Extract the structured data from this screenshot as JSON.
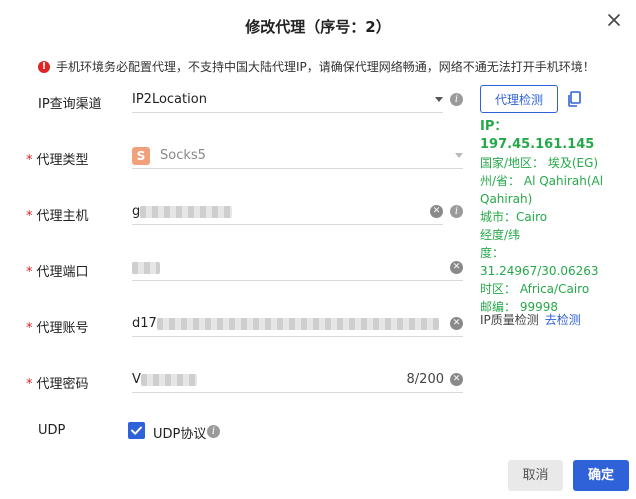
{
  "dialog": {
    "title": "修改代理（序号：2）"
  },
  "warning": {
    "text": "手机环境务必配置代理，不支持中国大陆代理IP，请确保代理网络畅通，网络不通无法打开手机环境！"
  },
  "form": {
    "channel": {
      "label": "IP查询渠道",
      "value": "IP2Location"
    },
    "proxy_type": {
      "label": "代理类型",
      "value": "Socks5",
      "icon_letter": "S"
    },
    "host": {
      "label": "代理主机",
      "value_prefix": "g"
    },
    "port": {
      "label": "代理端口"
    },
    "account": {
      "label": "代理账号",
      "value_prefix": "d17"
    },
    "password": {
      "label": "代理密码",
      "value_prefix": "V",
      "counter": "8/200"
    },
    "udp": {
      "label": "UDP",
      "checkbox_label": "UDP协议",
      "checked": true
    }
  },
  "check": {
    "button_label": "代理检测",
    "ip_line": "IP：197.45.161.145",
    "country_line": "国家/地区： 埃及(EG)",
    "region_line": "州/省： Al Qahirah(Al Qahirah)",
    "city_line": "城市：Cairo",
    "latlng_label": "经度/纬",
    "latlng_line": "度： 31.24967/30.06263",
    "timezone_line": "时区： Africa/Cairo",
    "zip_line": "邮编： 99998",
    "quality_label": "IP质量检测",
    "quality_link": "去检测"
  },
  "buttons": {
    "cancel": "取消",
    "ok": "确定"
  },
  "colors": {
    "primary": "#2f62d8",
    "success": "#26a84a",
    "danger": "#e02424"
  }
}
